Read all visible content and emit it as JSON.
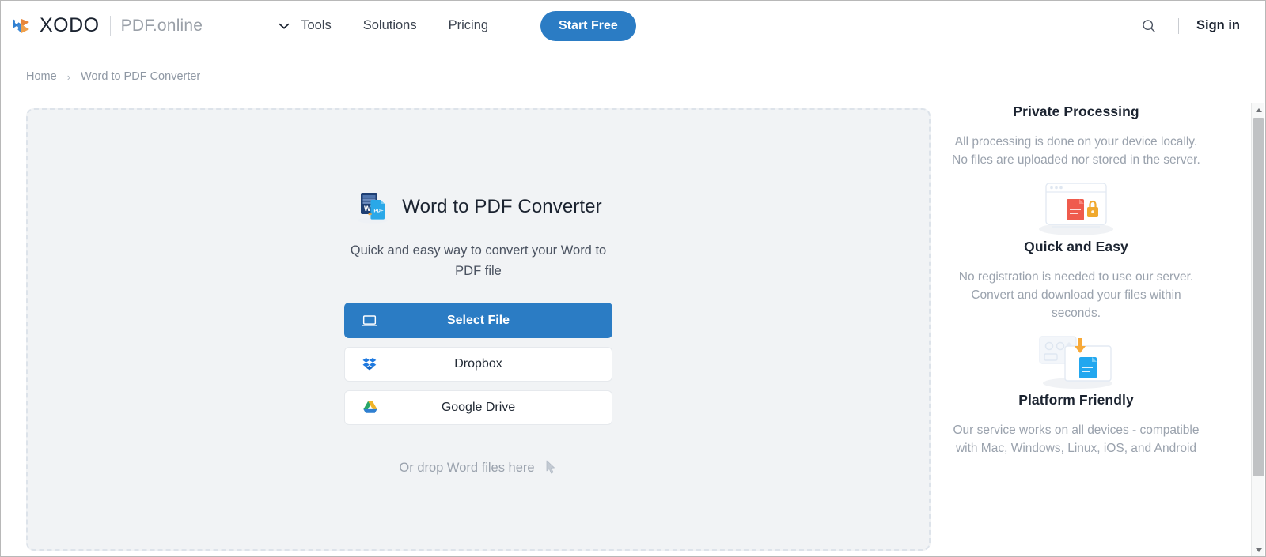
{
  "header": {
    "logo_icon": "xodo-butterfly-logo",
    "brand": "XODO",
    "brand_sub": "PDF.online",
    "nav_caret_icon": "chevron-down-icon",
    "nav": [
      {
        "label": "Tools"
      },
      {
        "label": "Solutions"
      },
      {
        "label": "Pricing"
      }
    ],
    "cta_label": "Start Free",
    "search_icon": "search-icon",
    "signin_label": "Sign in",
    "accent_color": "#2b7cc4"
  },
  "breadcrumb": {
    "home": "Home",
    "separator": "›",
    "current": "Word to PDF Converter"
  },
  "dropzone": {
    "title_icon": "word-to-pdf-icon",
    "title": "Word to PDF Converter",
    "subtitle": "Quick and easy way to convert your Word to PDF file",
    "buttons": [
      {
        "label": "Select File",
        "icon": "laptop-icon",
        "style": "primary"
      },
      {
        "label": "Dropbox",
        "icon": "dropbox-icon",
        "style": "secondary"
      },
      {
        "label": "Google Drive",
        "icon": "google-drive-icon",
        "style": "secondary"
      }
    ],
    "drop_hint": "Or drop Word files here",
    "drop_hint_icon": "drop-cursor-icon",
    "background_color": "#f1f3f5",
    "border_color": "#dde3ea"
  },
  "sidebar": {
    "features": [
      {
        "title": "Private Processing",
        "desc": "All processing is done on your device locally. No files are uploaded nor stored in the server.",
        "art_icon": "secure-browser-pdf-lock-illustration"
      },
      {
        "title": "Quick and Easy",
        "desc": "No registration is needed to use our server. Convert and download your files within seconds.",
        "art_icon": "fast-conversion-illustration"
      },
      {
        "title": "Platform Friendly",
        "desc": "Our service works on all devices - compatible with Mac, Windows, Linux, iOS, and Android",
        "art_icon": ""
      }
    ]
  },
  "scrollbar": {
    "up_icon": "scroll-up-arrow-icon",
    "down_icon": "scroll-down-arrow-icon",
    "thumb_label": "vertical-scroll-thumb"
  }
}
